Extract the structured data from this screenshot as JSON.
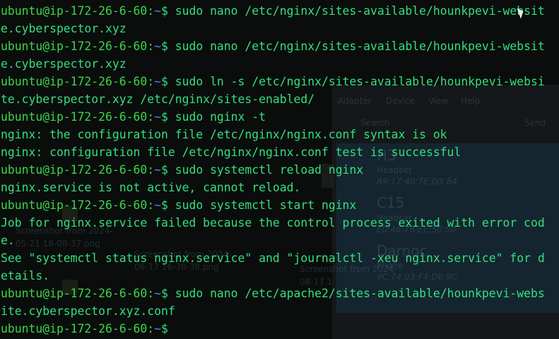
{
  "terminal": {
    "prompt_user": "ubuntu@ip-172-26-6-60",
    "prompt_path": "~",
    "prompt_symbol": "$",
    "lines": [
      {
        "type": "cmd",
        "text": " sudo nano /etc/nginx/sites-available/hounkpevi-websit"
      },
      {
        "type": "out",
        "text": "e.cyberspector.xyz"
      },
      {
        "type": "cmd",
        "text": " sudo nano /etc/nginx/sites-available/hounkpevi-websit"
      },
      {
        "type": "out",
        "text": "e.cyberspector.xyz"
      },
      {
        "type": "cmd",
        "text": " sudo ln -s /etc/nginx/sites-available/hounkpevi-websi"
      },
      {
        "type": "out",
        "text": "te.cyberspector.xyz /etc/nginx/sites-enabled/"
      },
      {
        "type": "cmd",
        "text": " sudo nginx -t"
      },
      {
        "type": "out",
        "text": "nginx: the configuration file /etc/nginx/nginx.conf syntax is ok"
      },
      {
        "type": "out",
        "text": "nginx: configuration file /etc/nginx/nginx.conf test is successful"
      },
      {
        "type": "cmd",
        "text": " sudo systemctl reload nginx"
      },
      {
        "type": "out",
        "text": "nginx.service is not active, cannot reload."
      },
      {
        "type": "cmd",
        "text": " sudo systemctl start nginx"
      },
      {
        "type": "out",
        "text": "Job for nginx.service failed because the control process exited with error cod"
      },
      {
        "type": "out",
        "text": "e."
      },
      {
        "type": "out",
        "text": "See \"systemctl status nginx.service\" and \"journalctl -xeu nginx.service\" for d"
      },
      {
        "type": "out",
        "text": "etails."
      },
      {
        "type": "cmd",
        "text": " sudo nano /etc/apache2/sites-available/hounkpevi-webs"
      },
      {
        "type": "out",
        "text": "ite.cyberspector.xyz.conf"
      },
      {
        "type": "cmd",
        "text": ""
      }
    ]
  },
  "background_window": {
    "menu_items": [
      "Adapter",
      "Device",
      "View",
      "Help"
    ],
    "search_placeholder": "Search",
    "devices": [
      {
        "name": "H3",
        "type": "Headset",
        "mac": "A9:17:40:7E:D5:84"
      },
      {
        "name": "C15",
        "type": "Headset",
        "mac": "E0:46:7B:EE:50:00"
      },
      {
        "name": "Darnoc",
        "type": "Phone",
        "mac": "9C:74:03:F4:D6:9C"
      }
    ],
    "send_label": "Send"
  },
  "desktop_files": [
    "Screenshot from 2024-",
    "05-21 18-08-37.png",
    "Screenshot from 2024-",
    "06-17 16-38-38.png",
    "Screenshot from 2024-",
    "08-17 1"
  ],
  "colors": {
    "background": "#0b0d0c",
    "prompt_user": "#38d84a",
    "prompt_path": "#5b7dff",
    "command_text": "#2fe07a"
  }
}
